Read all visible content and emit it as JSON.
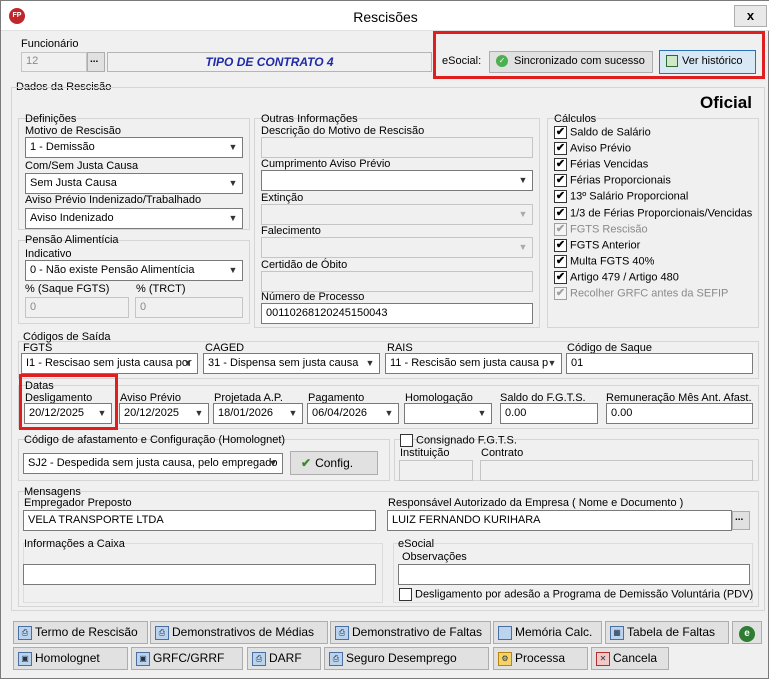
{
  "window": {
    "title": "Rescisões",
    "close": "x",
    "app_icon": "FP"
  },
  "funcionario": {
    "label": "Funcionário",
    "value": "12",
    "ellipsis": "...",
    "contract_type": "TIPO DE CONTRATO 4"
  },
  "esocial_top": {
    "label": "eSocial:",
    "status": "Sincronizado com sucesso",
    "history": "Ver histórico"
  },
  "dados": {
    "label": "Dados da Rescisão",
    "badge": "Oficial"
  },
  "definicoes": {
    "label": "Definições",
    "motivo_label": "Motivo de Rescisão",
    "motivo_value": "1 - Demissão",
    "justa_label": "Com/Sem Justa Causa",
    "justa_value": "Sem Justa Causa",
    "aviso_label": "Aviso Prévio Indenizado/Trabalhado",
    "aviso_value": "Aviso Indenizado"
  },
  "pensao": {
    "label": "Pensão Alimentícia",
    "indicativo_label": "Indicativo",
    "indicativo_value": "0 - Não existe Pensão Alimentícia",
    "saque_label": "% (Saque FGTS)",
    "saque_value": "0",
    "trct_label": "% (TRCT)",
    "trct_value": "0"
  },
  "outras": {
    "label": "Outras Informações",
    "descricao_label": "Descrição do Motivo de Rescisão",
    "cumprimento_label": "Cumprimento Aviso Prévio",
    "extincao_label": "Extinção",
    "falecimento_label": "Falecimento",
    "certidao_label": "Certidão de Óbito",
    "processo_label": "Número de Processo",
    "processo_value": "00110268120245150043"
  },
  "calculos": {
    "label": "Cálculos",
    "items": [
      {
        "label": "Saldo de Salário",
        "mark": "✔"
      },
      {
        "label": "Aviso Prévio",
        "mark": "✔"
      },
      {
        "label": "Férias Vencidas",
        "mark": "✔"
      },
      {
        "label": "Férias Proporcionais",
        "mark": "✔"
      },
      {
        "label": "13º Salário Proporcional",
        "mark": "✔"
      },
      {
        "label": "1/3 de Férias Proporcionais/Vencidas",
        "mark": "✔"
      },
      {
        "label": "FGTS Rescisão",
        "mark": "✔"
      },
      {
        "label": "FGTS Anterior",
        "mark": "✔"
      },
      {
        "label": "Multa FGTS 40%",
        "mark": "✔"
      },
      {
        "label": "Artigo 479 / Artigo 480",
        "mark": "✔"
      },
      {
        "label": "Recolher GRFC antes da SEFIP",
        "mark": "✔"
      }
    ]
  },
  "codigos": {
    "label": "Códigos de Saída",
    "fgts_label": "FGTS",
    "fgts_value": "I1 - Rescisao sem justa causa por",
    "caged_label": "CAGED",
    "caged_value": "31  - Dispensa sem justa causa",
    "rais_label": "RAIS",
    "rais_value": "11 - Rescisão sem justa causa p",
    "saque_label": "Código de Saque",
    "saque_value": "01"
  },
  "datas": {
    "label": "Datas",
    "desligamento_label": "Desligamento",
    "desligamento_value": "20/12/2025",
    "aviso_label": "Aviso Prévio",
    "aviso_value": "20/12/2025",
    "projetada_label": "Projetada A.P.",
    "projetada_value": "18/01/2026",
    "pagamento_label": "Pagamento",
    "pagamento_value": "06/04/2026",
    "homologacao_label": "Homologação",
    "saldo_label": "Saldo do F.G.T.S.",
    "saldo_value": "0.00",
    "remuneracao_label": "Remuneração Mês Ant. Afast.",
    "remuneracao_value": "0.00"
  },
  "afastamento": {
    "label": "Código de afastamento e Configuração (Homolognet)",
    "value": "SJ2 - Despedida sem justa causa, pelo empregado",
    "config": "Config."
  },
  "consignado": {
    "label": "Consignado F.G.T.S.",
    "instituicao_label": "Instituição",
    "contrato_label": "Contrato"
  },
  "mensagens": {
    "label": "Mensagens",
    "empregador_label": "Empregador Preposto",
    "empregador_value": "VELA TRANSPORTE LTDA",
    "responsavel_label": "Responsável Autorizado da Empresa ( Nome e Documento )",
    "responsavel_value": "LUIZ FERNANDO KURIHARA",
    "caixa_label": "Informações a Caixa",
    "esocial_label": "eSocial",
    "obs_label": "Observações",
    "pdv_label": "Desligamento por adesão a Programa de Demissão Voluntária (PDV)"
  },
  "buttons": {
    "termo": "Termo de Rescisão",
    "medias": "Demonstrativos de Médias",
    "faltas": "Demonstrativo de Faltas",
    "memoria": "Memória Calc.",
    "tabela": "Tabela de Faltas",
    "homolognet": "Homolognet",
    "grfc": "GRFC/GRRF",
    "darf": "DARF",
    "seguro": "Seguro Desemprego",
    "processa": "Processa",
    "cancela": "Cancela"
  }
}
